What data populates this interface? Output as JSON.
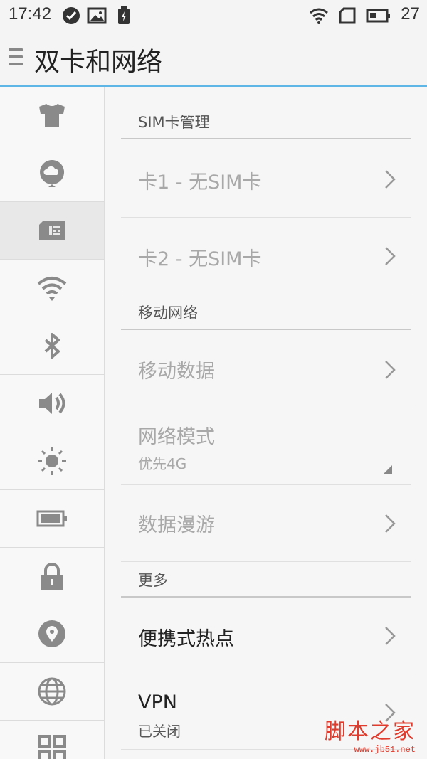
{
  "status_bar": {
    "time": "17:42",
    "battery_level": "27",
    "icons": [
      "check-circle-icon",
      "image-icon",
      "battery-saver-icon",
      "wifi-icon",
      "sim-icon",
      "battery-icon"
    ]
  },
  "header": {
    "title": "双卡和网络",
    "menu_icon": "menu-icon"
  },
  "sidebar": {
    "items": [
      {
        "icon": "theme-shirt-icon",
        "active": false
      },
      {
        "icon": "cloud-account-icon",
        "active": false
      },
      {
        "icon": "sim-card-icon",
        "active": true
      },
      {
        "icon": "wifi-icon",
        "active": false
      },
      {
        "icon": "bluetooth-icon",
        "active": false
      },
      {
        "icon": "volume-icon",
        "active": false
      },
      {
        "icon": "brightness-icon",
        "active": false
      },
      {
        "icon": "battery-icon",
        "active": false
      },
      {
        "icon": "lock-icon",
        "active": false
      },
      {
        "icon": "location-icon",
        "active": false
      },
      {
        "icon": "globe-icon",
        "active": false
      },
      {
        "icon": "apps-grid-icon",
        "active": false
      }
    ]
  },
  "sections": {
    "sim": {
      "header": "SIM卡管理",
      "card1": "卡1 - 无SIM卡",
      "card2": "卡2 - 无SIM卡"
    },
    "mobile": {
      "header": "移动网络",
      "mobile_data": "移动数据",
      "network_mode": "网络模式",
      "network_mode_value": "优先4G",
      "roaming": "数据漫游"
    },
    "more": {
      "header": "更多",
      "hotspot": "便携式热点",
      "vpn": "VPN",
      "vpn_status": "已关闭"
    }
  },
  "watermark": {
    "main": "脚本之家",
    "sub": "www.jb51.net"
  },
  "colors": {
    "accent_line": "#5eb6e6",
    "icon_gray": "#8a8a8a",
    "watermark": "#e03b2c"
  }
}
